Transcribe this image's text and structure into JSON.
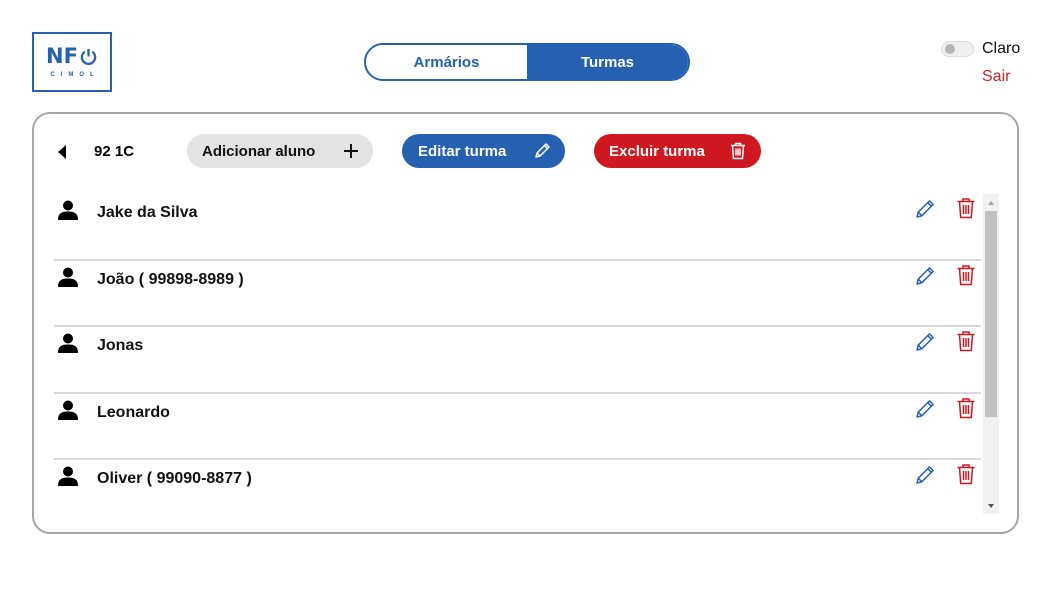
{
  "logo": {
    "main": "NF",
    "sub": "CIMOL"
  },
  "tabs": [
    {
      "label": "Armários",
      "active": false
    },
    {
      "label": "Turmas",
      "active": true
    }
  ],
  "theme": {
    "label": "Claro",
    "enabled": false
  },
  "logout_label": "Sair",
  "toolbar": {
    "class_name": "92 1C",
    "add_label": "Adicionar aluno",
    "edit_label": "Editar turma",
    "delete_label": "Excluir turma"
  },
  "students": [
    {
      "name": "Jake da Silva"
    },
    {
      "name": "João ( 99898-8989 )"
    },
    {
      "name": "Jonas"
    },
    {
      "name": "Leonardo"
    },
    {
      "name": "Oliver ( 99090-8877 )"
    }
  ],
  "colors": {
    "primary": "#2660b0",
    "danger": "#d01820",
    "logout": "#c9252c",
    "neutral_button": "#e3e3e3",
    "border": "#a6a6a6"
  },
  "icons": {
    "back": "caret-left-icon",
    "add": "plus-icon",
    "edit": "pencil-icon",
    "delete": "trash-icon",
    "user": "person-icon",
    "logo_power": "power-icon"
  }
}
